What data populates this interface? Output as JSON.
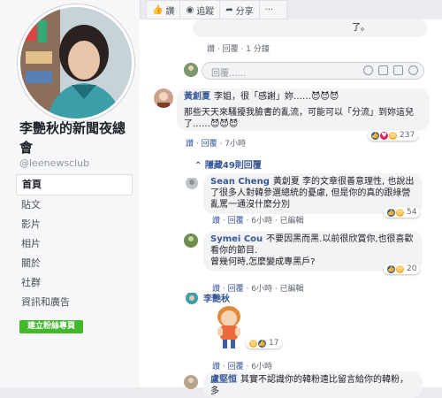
{
  "sidebar": {
    "page_title": "李艷秋的新聞夜總會",
    "handle": "@leenewsclub",
    "nav": [
      "首頁",
      "貼文",
      "影片",
      "相片",
      "關於",
      "社群",
      "資訊和廣告"
    ],
    "create_button": "建立粉絲專頁"
  },
  "toolbar": {
    "like": "讚",
    "follow": "追蹤",
    "share": "分享",
    "more": "···"
  },
  "top_comment": {
    "text_tail": "了。",
    "actions": "讚 · 回覆 · 1 分鐘"
  },
  "reply_input": {
    "placeholder": "回覆......"
  },
  "comment_main": {
    "author": "黃創夏",
    "text1": "李姐，很「感謝」妳……😈😈😈",
    "text2": "那些天天來騷擾我臉書的亂流，可能可以「分流」到妳這兒了……😈😈😈",
    "like": "讚",
    "reply": "回覆",
    "time": "7小時",
    "reactions": "237"
  },
  "hidden_replies": "隱藏49則回覆",
  "replies": [
    {
      "author": "Sean Cheng",
      "text": "黃創夏 李的文章很善意理性, 也說出了很多人對韓參選總統的憂慮, 但是你的真的跟綠營亂罵一通沒什麼分別",
      "like": "讚",
      "reply": "回覆",
      "time": "6小時",
      "edited": "已編輯",
      "reactions": "54"
    },
    {
      "author": "Symei Cou",
      "text": "不要因黑而黑.以前很欣賞你,也很喜歡看你的節目.",
      "text2": "曾幾何時,怎麼變成專黑戶?",
      "like": "讚",
      "reply": "回覆",
      "time": "6小時",
      "edited": "已編輯",
      "reactions": "20"
    },
    {
      "author": "李艷秋",
      "like": "讚",
      "reply": "回覆",
      "time": "6小時",
      "reactions": "17"
    },
    {
      "author": "盧堅恒",
      "text": "其實不認識你的韓粉遠比留言給你的韓粉，多"
    }
  ],
  "colors": {
    "link": "#385898",
    "green": "#42b72a",
    "bubble": "#f2f3f5"
  }
}
